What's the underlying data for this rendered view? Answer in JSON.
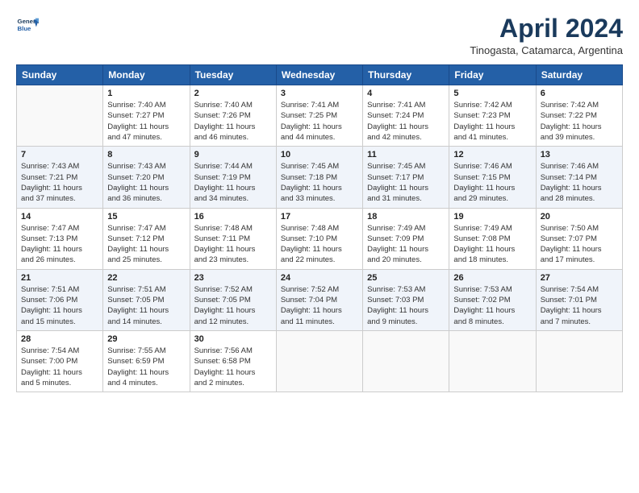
{
  "logo": {
    "line1": "General",
    "line2": "Blue"
  },
  "title": "April 2024",
  "subtitle": "Tinogasta, Catamarca, Argentina",
  "days_header": [
    "Sunday",
    "Monday",
    "Tuesday",
    "Wednesday",
    "Thursday",
    "Friday",
    "Saturday"
  ],
  "weeks": [
    [
      {
        "day": "",
        "info": ""
      },
      {
        "day": "1",
        "info": "Sunrise: 7:40 AM\nSunset: 7:27 PM\nDaylight: 11 hours\nand 47 minutes."
      },
      {
        "day": "2",
        "info": "Sunrise: 7:40 AM\nSunset: 7:26 PM\nDaylight: 11 hours\nand 46 minutes."
      },
      {
        "day": "3",
        "info": "Sunrise: 7:41 AM\nSunset: 7:25 PM\nDaylight: 11 hours\nand 44 minutes."
      },
      {
        "day": "4",
        "info": "Sunrise: 7:41 AM\nSunset: 7:24 PM\nDaylight: 11 hours\nand 42 minutes."
      },
      {
        "day": "5",
        "info": "Sunrise: 7:42 AM\nSunset: 7:23 PM\nDaylight: 11 hours\nand 41 minutes."
      },
      {
        "day": "6",
        "info": "Sunrise: 7:42 AM\nSunset: 7:22 PM\nDaylight: 11 hours\nand 39 minutes."
      }
    ],
    [
      {
        "day": "7",
        "info": "Sunrise: 7:43 AM\nSunset: 7:21 PM\nDaylight: 11 hours\nand 37 minutes."
      },
      {
        "day": "8",
        "info": "Sunrise: 7:43 AM\nSunset: 7:20 PM\nDaylight: 11 hours\nand 36 minutes."
      },
      {
        "day": "9",
        "info": "Sunrise: 7:44 AM\nSunset: 7:19 PM\nDaylight: 11 hours\nand 34 minutes."
      },
      {
        "day": "10",
        "info": "Sunrise: 7:45 AM\nSunset: 7:18 PM\nDaylight: 11 hours\nand 33 minutes."
      },
      {
        "day": "11",
        "info": "Sunrise: 7:45 AM\nSunset: 7:17 PM\nDaylight: 11 hours\nand 31 minutes."
      },
      {
        "day": "12",
        "info": "Sunrise: 7:46 AM\nSunset: 7:15 PM\nDaylight: 11 hours\nand 29 minutes."
      },
      {
        "day": "13",
        "info": "Sunrise: 7:46 AM\nSunset: 7:14 PM\nDaylight: 11 hours\nand 28 minutes."
      }
    ],
    [
      {
        "day": "14",
        "info": "Sunrise: 7:47 AM\nSunset: 7:13 PM\nDaylight: 11 hours\nand 26 minutes."
      },
      {
        "day": "15",
        "info": "Sunrise: 7:47 AM\nSunset: 7:12 PM\nDaylight: 11 hours\nand 25 minutes."
      },
      {
        "day": "16",
        "info": "Sunrise: 7:48 AM\nSunset: 7:11 PM\nDaylight: 11 hours\nand 23 minutes."
      },
      {
        "day": "17",
        "info": "Sunrise: 7:48 AM\nSunset: 7:10 PM\nDaylight: 11 hours\nand 22 minutes."
      },
      {
        "day": "18",
        "info": "Sunrise: 7:49 AM\nSunset: 7:09 PM\nDaylight: 11 hours\nand 20 minutes."
      },
      {
        "day": "19",
        "info": "Sunrise: 7:49 AM\nSunset: 7:08 PM\nDaylight: 11 hours\nand 18 minutes."
      },
      {
        "day": "20",
        "info": "Sunrise: 7:50 AM\nSunset: 7:07 PM\nDaylight: 11 hours\nand 17 minutes."
      }
    ],
    [
      {
        "day": "21",
        "info": "Sunrise: 7:51 AM\nSunset: 7:06 PM\nDaylight: 11 hours\nand 15 minutes."
      },
      {
        "day": "22",
        "info": "Sunrise: 7:51 AM\nSunset: 7:05 PM\nDaylight: 11 hours\nand 14 minutes."
      },
      {
        "day": "23",
        "info": "Sunrise: 7:52 AM\nSunset: 7:05 PM\nDaylight: 11 hours\nand 12 minutes."
      },
      {
        "day": "24",
        "info": "Sunrise: 7:52 AM\nSunset: 7:04 PM\nDaylight: 11 hours\nand 11 minutes."
      },
      {
        "day": "25",
        "info": "Sunrise: 7:53 AM\nSunset: 7:03 PM\nDaylight: 11 hours\nand 9 minutes."
      },
      {
        "day": "26",
        "info": "Sunrise: 7:53 AM\nSunset: 7:02 PM\nDaylight: 11 hours\nand 8 minutes."
      },
      {
        "day": "27",
        "info": "Sunrise: 7:54 AM\nSunset: 7:01 PM\nDaylight: 11 hours\nand 7 minutes."
      }
    ],
    [
      {
        "day": "28",
        "info": "Sunrise: 7:54 AM\nSunset: 7:00 PM\nDaylight: 11 hours\nand 5 minutes."
      },
      {
        "day": "29",
        "info": "Sunrise: 7:55 AM\nSunset: 6:59 PM\nDaylight: 11 hours\nand 4 minutes."
      },
      {
        "day": "30",
        "info": "Sunrise: 7:56 AM\nSunset: 6:58 PM\nDaylight: 11 hours\nand 2 minutes."
      },
      {
        "day": "",
        "info": ""
      },
      {
        "day": "",
        "info": ""
      },
      {
        "day": "",
        "info": ""
      },
      {
        "day": "",
        "info": ""
      }
    ]
  ]
}
